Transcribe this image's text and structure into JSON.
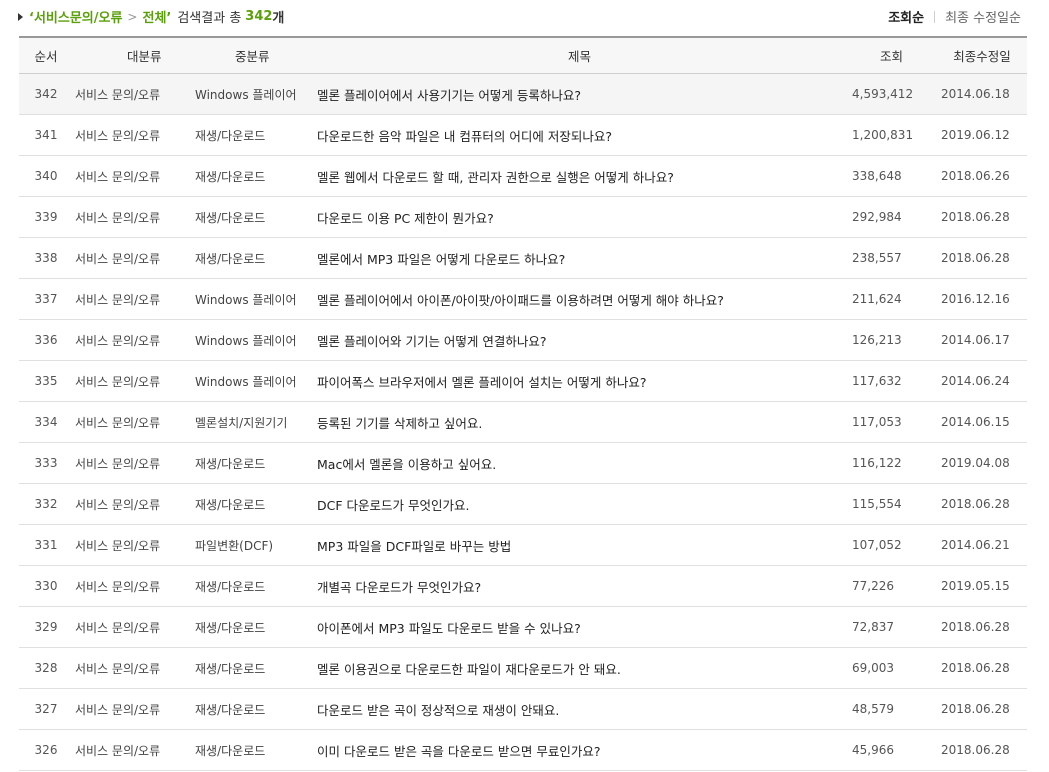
{
  "breadcrumb": {
    "category": "‘서비스문의/오류",
    "separator": ">",
    "scope": "전체’",
    "result_label": "검색결과 총",
    "total_count": "342",
    "count_unit": "개"
  },
  "sort": {
    "active": "조회순",
    "inactive": "최종 수정일순"
  },
  "table": {
    "headers": [
      "순서",
      "대분류",
      "중분류",
      "제목",
      "조회",
      "최종수정일"
    ],
    "rows": [
      {
        "no": "342",
        "category": "서비스 문의/오류",
        "subcategory": "Windows 플레이어",
        "title": "멜론 플레이어에서 사용기기는 어떻게 등록하나요?",
        "views": "4,593,412",
        "date": "2014.06.18"
      },
      {
        "no": "341",
        "category": "서비스 문의/오류",
        "subcategory": "재생/다운로드",
        "title": "다운로드한 음악 파일은 내 컴퓨터의 어디에 저장되나요?",
        "views": "1,200,831",
        "date": "2019.06.12"
      },
      {
        "no": "340",
        "category": "서비스 문의/오류",
        "subcategory": "재생/다운로드",
        "title": "멜론 웹에서 다운로드 할 때, 관리자 권한으로 실행은 어떻게 하나요?",
        "views": "338,648",
        "date": "2018.06.26"
      },
      {
        "no": "339",
        "category": "서비스 문의/오류",
        "subcategory": "재생/다운로드",
        "title": "다운로드 이용 PC 제한이 뭔가요?",
        "views": "292,984",
        "date": "2018.06.28"
      },
      {
        "no": "338",
        "category": "서비스 문의/오류",
        "subcategory": "재생/다운로드",
        "title": "멜론에서 MP3 파일은 어떻게 다운로드 하나요?",
        "views": "238,557",
        "date": "2018.06.28"
      },
      {
        "no": "337",
        "category": "서비스 문의/오류",
        "subcategory": "Windows 플레이어",
        "title": "멜론 플레이어에서 아이폰/아이팟/아이패드를 이용하려면 어떻게 해야 하나요?",
        "views": "211,624",
        "date": "2016.12.16"
      },
      {
        "no": "336",
        "category": "서비스 문의/오류",
        "subcategory": "Windows 플레이어",
        "title": "멜론 플레이어와 기기는 어떻게 연결하나요?",
        "views": "126,213",
        "date": "2014.06.17"
      },
      {
        "no": "335",
        "category": "서비스 문의/오류",
        "subcategory": "Windows 플레이어",
        "title": "파이어폭스 브라우저에서 멜론 플레이어 설치는 어떻게 하나요?",
        "views": "117,632",
        "date": "2014.06.24"
      },
      {
        "no": "334",
        "category": "서비스 문의/오류",
        "subcategory": "멜론설치/지원기기",
        "title": "등록된 기기를 삭제하고 싶어요.",
        "views": "117,053",
        "date": "2014.06.15"
      },
      {
        "no": "333",
        "category": "서비스 문의/오류",
        "subcategory": "재생/다운로드",
        "title": "Mac에서 멜론을 이용하고 싶어요.",
        "views": "116,122",
        "date": "2019.04.08"
      },
      {
        "no": "332",
        "category": "서비스 문의/오류",
        "subcategory": "재생/다운로드",
        "title": "DCF 다운로드가 무엇인가요.",
        "views": "115,554",
        "date": "2018.06.28"
      },
      {
        "no": "331",
        "category": "서비스 문의/오류",
        "subcategory": "파일변환(DCF)",
        "title": "MP3 파일을 DCF파일로 바꾸는 방법",
        "views": "107,052",
        "date": "2014.06.21"
      },
      {
        "no": "330",
        "category": "서비스 문의/오류",
        "subcategory": "재생/다운로드",
        "title": "개별곡 다운로드가 무엇인가요?",
        "views": "77,226",
        "date": "2019.05.15"
      },
      {
        "no": "329",
        "category": "서비스 문의/오류",
        "subcategory": "재생/다운로드",
        "title": "아이폰에서 MP3 파일도 다운로드 받을 수 있나요?",
        "views": "72,837",
        "date": "2018.06.28"
      },
      {
        "no": "328",
        "category": "서비스 문의/오류",
        "subcategory": "재생/다운로드",
        "title": "멜론 이용권으로 다운로드한 파일이 재다운로드가 안 돼요.",
        "views": "69,003",
        "date": "2018.06.28"
      },
      {
        "no": "327",
        "category": "서비스 문의/오류",
        "subcategory": "재생/다운로드",
        "title": "다운로드 받은 곡이 정상적으로 재생이 안돼요.",
        "views": "48,579",
        "date": "2018.06.28"
      },
      {
        "no": "326",
        "category": "서비스 문의/오류",
        "subcategory": "재생/다운로드",
        "title": "이미 다운로드 받은 곡을 다운로드 받으면 무료인가요?",
        "views": "45,966",
        "date": "2018.06.28"
      }
    ]
  },
  "colors": {
    "accent_green": "#5aa00a",
    "header_bg": "#f7f7f7",
    "highlight_row_bg": "#f5f5f5"
  }
}
